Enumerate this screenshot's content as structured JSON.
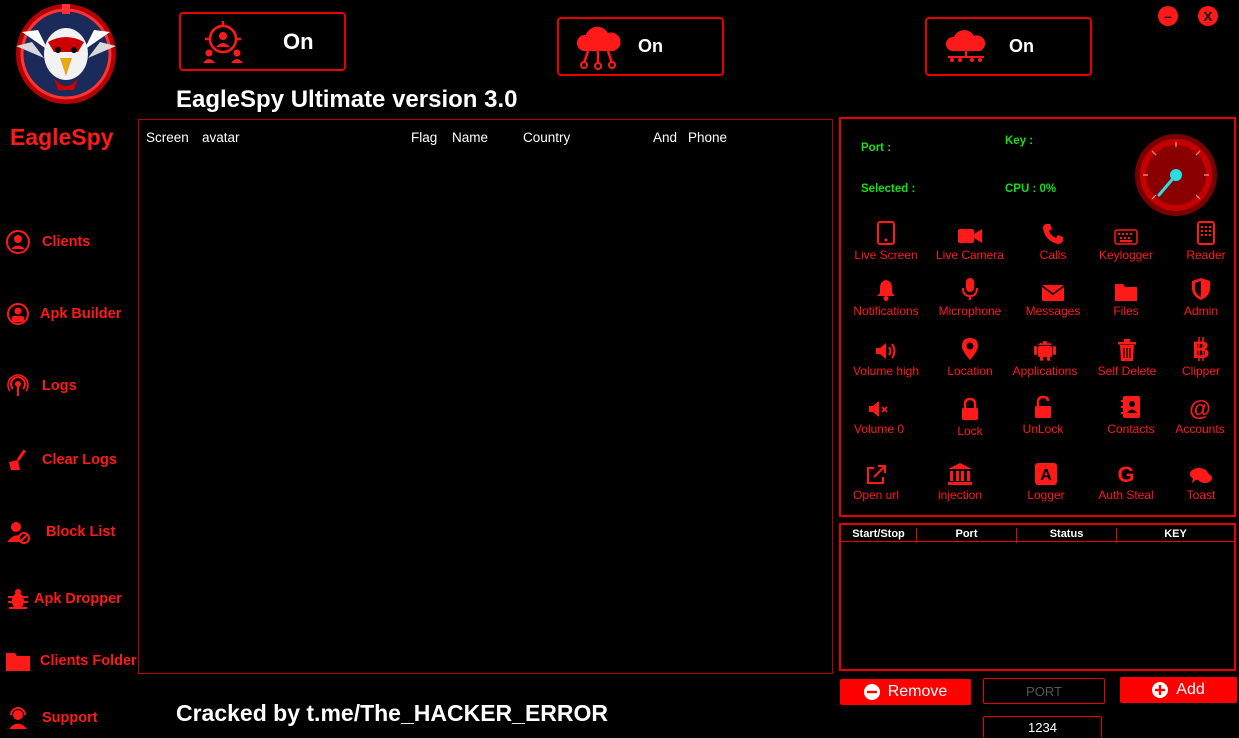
{
  "brand": {
    "name": "EagleSpy",
    "accent": "#ff1a1a"
  },
  "app_title": "EagleSpy Ultimate version 3.0",
  "footer_text": "Cracked by t.me/The_HACKER_ERROR",
  "window": {
    "minimize": "–",
    "close": "X"
  },
  "status": {
    "server1": {
      "icon": "people-target-icon",
      "label": "On"
    },
    "server2": {
      "icon": "cloud-network-icon",
      "label": "On"
    },
    "server3": {
      "icon": "cloud-connect-icon",
      "label": "On"
    }
  },
  "sidebar": {
    "items": [
      {
        "label": "Clients",
        "icon": "user-icon"
      },
      {
        "label": "Apk Builder",
        "icon": "builder-icon"
      },
      {
        "label": "Logs",
        "icon": "broadcast-icon"
      },
      {
        "label": "Clear Logs",
        "icon": "broom-icon"
      },
      {
        "label": "Block List",
        "icon": "user-block-icon"
      },
      {
        "label": "Apk Dropper",
        "icon": "bug-icon"
      },
      {
        "label": "Clients Folder",
        "icon": "folder-icon"
      },
      {
        "label": "Support",
        "icon": "support-agent-icon"
      }
    ]
  },
  "clients_table": {
    "columns": [
      "Screen",
      "avatar",
      "Flag",
      "Name",
      "Country",
      "And",
      "Phone"
    ]
  },
  "info": {
    "port_label": "Port :",
    "key_label": "Key :",
    "selected_label": "Selected :",
    "cpu_label": "CPU : 0%",
    "cpu_percent": 0,
    "info_color": "#14e014"
  },
  "commands": [
    [
      {
        "label": "Live Screen",
        "icon": "tablet-icon"
      },
      {
        "label": "Live Camera",
        "icon": "video-camera-icon"
      },
      {
        "label": "Calls",
        "icon": "phone-icon"
      },
      {
        "label": "Keylogger",
        "icon": "keyboard-icon"
      },
      {
        "label": "Reader",
        "icon": "reader-icon"
      }
    ],
    [
      {
        "label": "Notifications",
        "icon": "bell-icon"
      },
      {
        "label": "Microphone",
        "icon": "microphone-icon"
      },
      {
        "label": "Messages",
        "icon": "envelope-icon"
      },
      {
        "label": "Files",
        "icon": "folder-icon"
      },
      {
        "label": "Admin",
        "icon": "shield-icon"
      }
    ],
    [
      {
        "label": "Volume high",
        "icon": "volume-high-icon"
      },
      {
        "label": "Location",
        "icon": "location-pin-icon"
      },
      {
        "label": "Applications",
        "icon": "android-icon"
      },
      {
        "label": "Self Delete",
        "icon": "trash-icon"
      },
      {
        "label": "Clipper",
        "icon": "bitcoin-icon"
      }
    ],
    [
      {
        "label": "Volume 0",
        "icon": "volume-mute-icon"
      },
      {
        "label": "Lock",
        "icon": "lock-icon"
      },
      {
        "label": "UnLock",
        "icon": "unlock-icon"
      },
      {
        "label": "Contacts",
        "icon": "contacts-icon"
      },
      {
        "label": "Accounts",
        "icon": "at-icon"
      }
    ],
    [
      {
        "label": "Open url",
        "icon": "external-link-icon"
      },
      {
        "label": "injection",
        "icon": "bank-icon"
      },
      {
        "label": "Logger",
        "icon": "logger-icon"
      },
      {
        "label": "Auth Steal",
        "icon": "google-icon"
      },
      {
        "label": "Toast",
        "icon": "chat-bubbles-icon"
      }
    ]
  ],
  "port_table": {
    "columns": [
      "Start/Stop",
      "Port",
      "Status",
      "KEY"
    ]
  },
  "buttons": {
    "remove": "Remove",
    "add": "Add"
  },
  "port_input": {
    "placeholder": "PORT",
    "value": "1234"
  }
}
